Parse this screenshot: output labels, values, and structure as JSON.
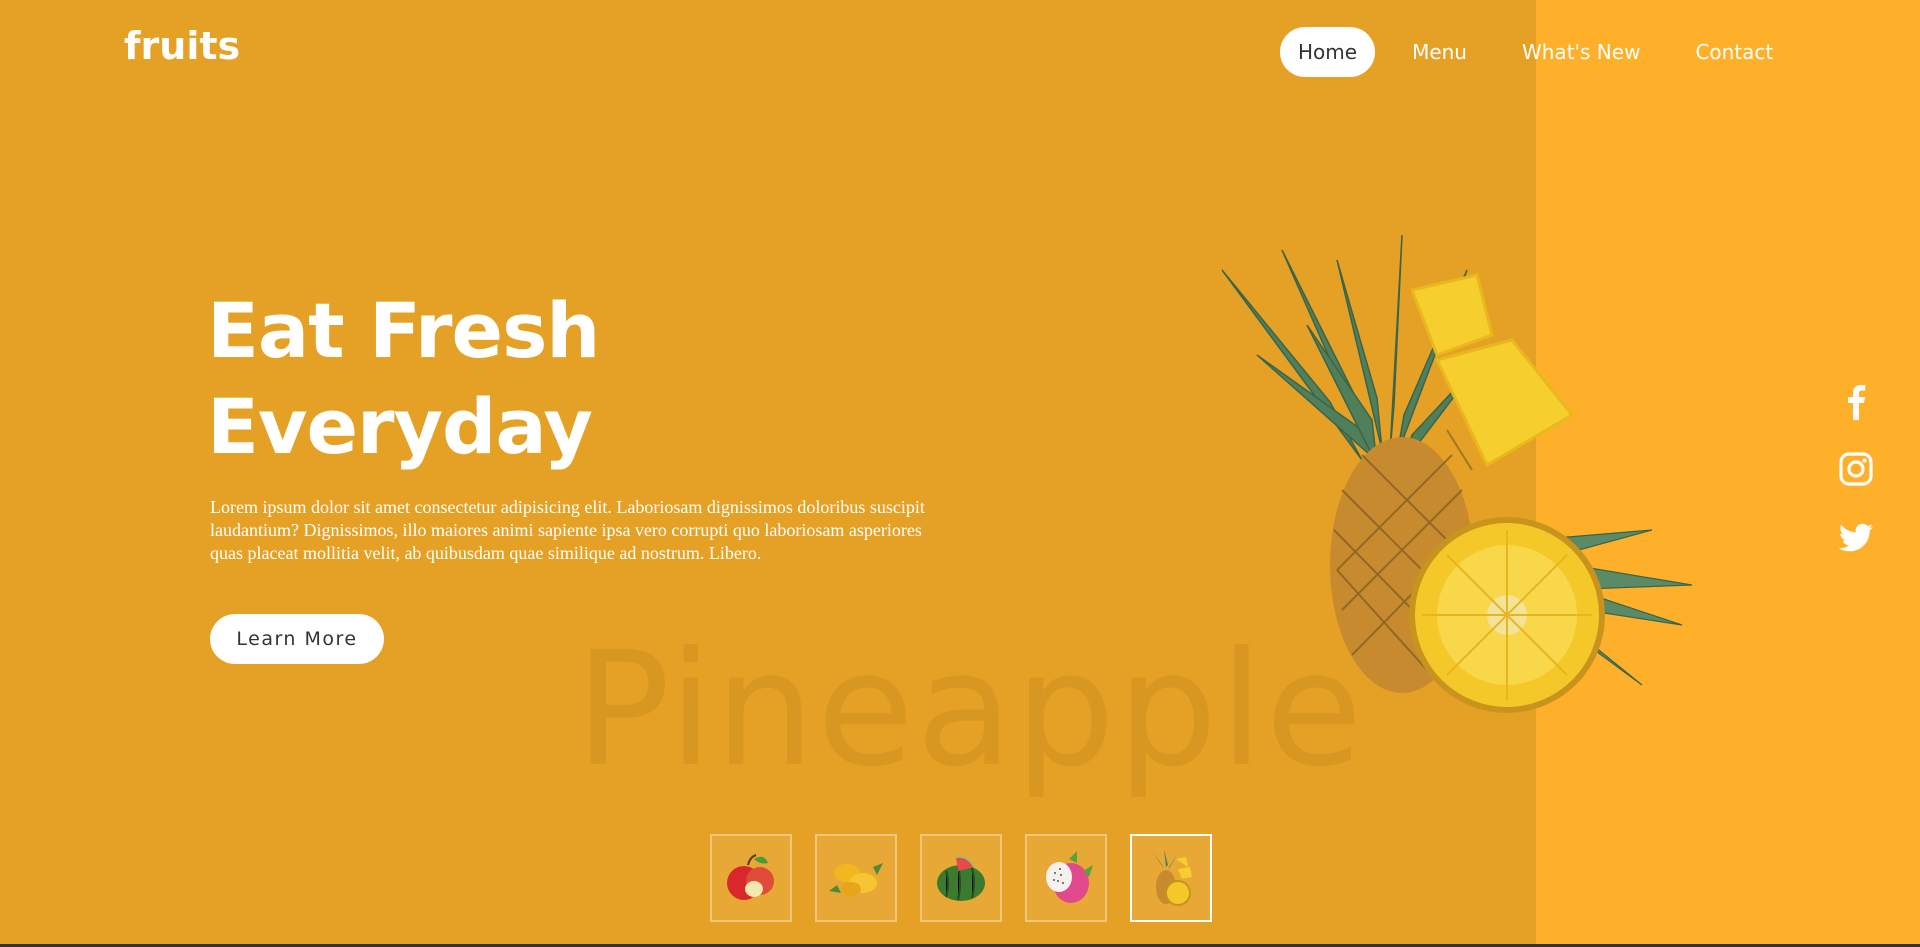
{
  "brand": {
    "logo_text": "fruits"
  },
  "nav": {
    "items": [
      {
        "label": "Home",
        "active": true
      },
      {
        "label": "Menu",
        "active": false
      },
      {
        "label": "What's New",
        "active": false
      },
      {
        "label": "Contact",
        "active": false
      }
    ]
  },
  "hero": {
    "title_line1": "Eat Fresh",
    "title_line2": "Everyday",
    "body": "Lorem ipsum dolor sit amet consectetur adipisicing elit. Laboriosam dignissimos doloribus suscipit laudantium? Dignissimos, illo maiores animi sapiente ipsa vero corrupti quo laboriosam asperiores quas placeat mollitia velit, ab quibusdam quae similique ad nostrum. Libero.",
    "cta_label": "Learn More",
    "watermark_text": "Pineapple",
    "featured_fruit_icon": "pineapple-image"
  },
  "social": [
    {
      "name": "facebook-icon"
    },
    {
      "name": "instagram-icon"
    },
    {
      "name": "twitter-icon"
    }
  ],
  "thumbnails": [
    {
      "icon": "apple-thumbnail",
      "active": false
    },
    {
      "icon": "mango-thumbnail",
      "active": false
    },
    {
      "icon": "watermelon-thumbnail",
      "active": false
    },
    {
      "icon": "dragonfruit-thumbnail",
      "active": false
    },
    {
      "icon": "pineapple-thumbnail",
      "active": true
    }
  ],
  "colors": {
    "background": "#e5a125",
    "right_panel": "#ffb02a",
    "text_light": "#ffffff",
    "button_text": "#333333"
  }
}
